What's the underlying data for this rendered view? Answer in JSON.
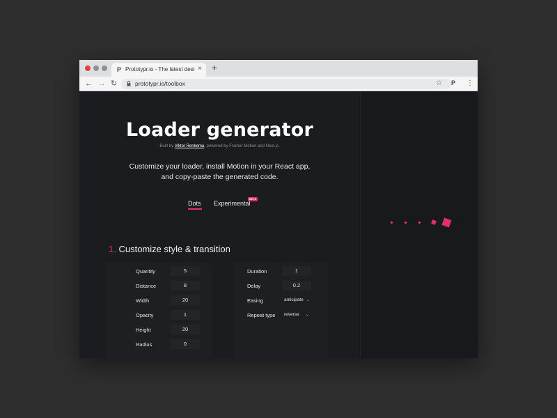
{
  "browser": {
    "tab_favicon": "P",
    "tab_title": "Prototypr.io - The latest design and",
    "tab_close": "×",
    "new_tab": "+",
    "back": "←",
    "forward": "→",
    "reload": "↻",
    "url": "prototypr.io/toolbox",
    "star": "☆",
    "extension": "P",
    "menu": "⋮"
  },
  "page": {
    "title": "Loader generator",
    "byline_prefix": "Built by",
    "byline_author": "Viktor Renkema",
    "byline_suffix": ", powered by Framer Motion and Next.js.",
    "lead_line1": "Customize your loader, install Motion in your React app,",
    "lead_line2": "and copy-paste the generated code.",
    "tabs": [
      {
        "label": "Dots",
        "active": true
      },
      {
        "label": "Experimental",
        "badge": "BETA"
      }
    ],
    "section_number": "1.",
    "section_title": "Customize style & transition"
  },
  "style_fields": [
    {
      "label": "Quantity",
      "value": "5"
    },
    {
      "label": "Distance",
      "value": "8"
    },
    {
      "label": "Width",
      "value": "20"
    },
    {
      "label": "Opacity",
      "value": "1"
    },
    {
      "label": "Height",
      "value": "20"
    },
    {
      "label": "Radius",
      "value": "0"
    }
  ],
  "transition_fields": [
    {
      "label": "Duration",
      "value": "1"
    },
    {
      "label": "Delay",
      "value": "0.2"
    },
    {
      "label": "Easing",
      "value": "anticipate",
      "chevron": "⌄"
    },
    {
      "label": "Repeat type",
      "value": "reverse",
      "chevron": "⌄"
    }
  ],
  "colors": {
    "accent": "#e0306a",
    "background": "#1b1c1f",
    "panel": "#1e1f22"
  },
  "icons": {
    "back": "arrow-left-icon",
    "forward": "arrow-right-icon",
    "reload": "reload-icon",
    "lock": "lock-icon",
    "star": "star-icon",
    "menu": "kebab-menu-icon"
  }
}
